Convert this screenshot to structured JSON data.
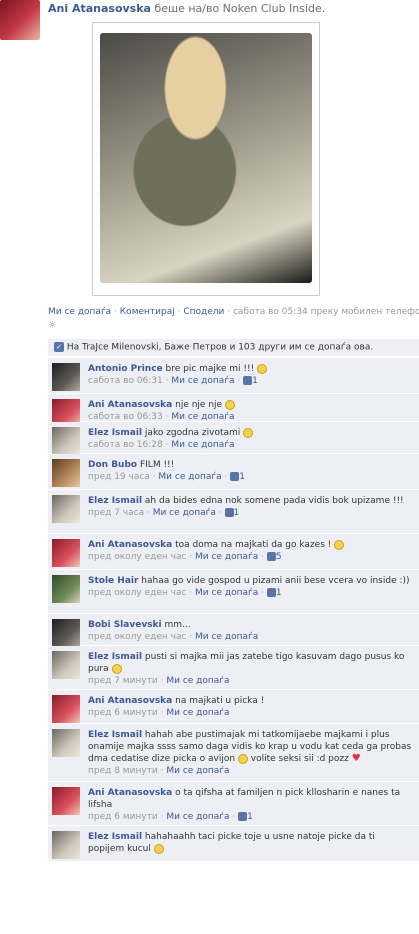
{
  "post": {
    "author": "Ani Atanasovska",
    "action": "беше на/во Noken Club Inside.",
    "actions": {
      "like": "Ми се допаѓа",
      "comment": "Коментирај",
      "share": "Сподели",
      "time": "сабота во 05:34 преку мобилен телефон",
      "sep": " · "
    },
    "gear": "☼",
    "likes_text": "На TraJce Milenovski, Баже Петров и 103 други им се допаѓа ова."
  },
  "comments": [
    {
      "name": "Antonio Prince",
      "text": "bre pic majke mi !!! ",
      "smiley": true,
      "time": "сабота во 06:31",
      "like": "Ми се допаѓа",
      "count": "1"
    },
    {
      "name": "Ani Atanasovska",
      "text": "nje nje nje ",
      "smiley": true,
      "time": "сабота во 06:33",
      "like": "Ми се допаѓа",
      "count": ""
    },
    {
      "name": "Elez Ismail",
      "text": "jako zgodna zivotami ",
      "smiley": true,
      "time": "сабота во 16:28",
      "like": "Ми се допаѓа",
      "count": ""
    },
    {
      "name": "Don Bubo",
      "text": "FILM !!!",
      "smiley": false,
      "time": "пред 19 часа",
      "like": "Ми се допаѓа",
      "count": "1"
    },
    {
      "name": "Elez Ismail",
      "text": "ah da bides edna nok somene pada vidis bok upizame !!!",
      "smiley": false,
      "time": "пред 7 часа",
      "like": "Ми се допаѓа",
      "count": "1"
    },
    {
      "name": "Ani Atanasovska",
      "text": "toa doma na majkati da go kazes ! ",
      "smiley": true,
      "time": "пред околу еден час",
      "like": "Ми се допаѓа",
      "count": "5"
    },
    {
      "name": "Stole Hair",
      "text": "hahaa go vide gospod u pizami anii bese vcera vo inside :))",
      "smiley": false,
      "time": "пред околу еден час",
      "like": "Ми се допаѓа",
      "count": "1"
    },
    {
      "name": "Bobi Slavevski",
      "text": "mm...",
      "smiley": false,
      "time": "пред околу еден час",
      "like": "Ми се допаѓа",
      "count": ""
    },
    {
      "name": "Elez Ismail",
      "text": "pusti si majka mii jas zatebe tigo kasuvam dago pusus ko pura ",
      "smiley": true,
      "time": "пред 7 минути",
      "like": "Ми се допаѓа",
      "count": ""
    },
    {
      "name": "Ani Atanasovska",
      "text": "na majkati u picka !",
      "smiley": false,
      "time": "пред 6 минути",
      "like": "Ми се допаѓа",
      "count": ""
    },
    {
      "name": "Elez Ismail",
      "text": "hahah abe pustimajak mi tatkomijaebe majkami i plus onamije majka ssss samo daga vidis ko krap u vodu kat ceda ga probas dma cedatise dize picka o avijon ",
      "text2": " volite seksi sii :d pozz ",
      "smiley": true,
      "heart": "♥",
      "time": "пред 8 минути",
      "like": "Ми се допаѓа",
      "count": ""
    },
    {
      "name": "Ani Atanasovska",
      "text": "o ta qifsha at familjen n pick kllosharin e nanes ta lifsha",
      "smiley": false,
      "time": "пред 6 минути",
      "like": "Ми се допаѓа",
      "count": "1"
    },
    {
      "name": "Elez Ismail",
      "text": "hahahaahh taci picke toje u usne natoje picke da ti popijem kucul ",
      "smiley": true,
      "time": "",
      "like": "",
      "count": ""
    }
  ]
}
